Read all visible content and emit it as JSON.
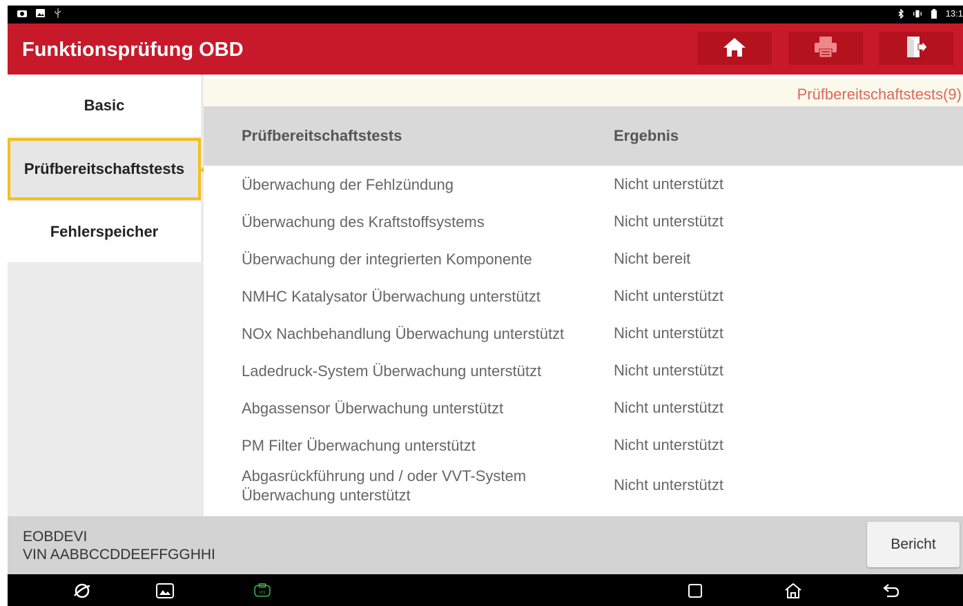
{
  "statusbar": {
    "time": "13:1",
    "left_icons": [
      "camera-icon",
      "image-icon",
      "usb-icon"
    ],
    "right_icons": [
      "bluetooth-icon",
      "vibrate-icon",
      "battery-icon"
    ]
  },
  "header": {
    "title": "Funktionsprüfung OBD",
    "color": "#c8192b",
    "buttons": [
      "home-icon",
      "printer-icon",
      "exit-icon"
    ]
  },
  "sidebar": {
    "items": [
      {
        "label": "Basic",
        "selected": false
      },
      {
        "label": "Prüfbereitschaftstests",
        "selected": true
      },
      {
        "label": "Fehlerspeicher",
        "selected": false
      }
    ],
    "highlight_color": "#f3c01a"
  },
  "content": {
    "notice": "Prüfbereitschaftstests(9)",
    "columns": [
      "Prüfbereitschaftstests",
      "Ergebnis"
    ],
    "rows": [
      {
        "test": "Überwachung der Fehlzündung",
        "result": "Nicht unterstützt"
      },
      {
        "test": "Überwachung des Kraftstoffsystems",
        "result": "Nicht unterstützt"
      },
      {
        "test": "Überwachung der integrierten Komponente",
        "result": "Nicht bereit"
      },
      {
        "test": "NMHC Katalysator Überwachung unterstützt",
        "result": "Nicht unterstützt"
      },
      {
        "test": "NOx Nachbehandlung Überwachung unterstützt",
        "result": "Nicht unterstützt"
      },
      {
        "test": "Ladedruck-System Überwachung unterstützt",
        "result": "Nicht unterstützt"
      },
      {
        "test": "Abgassensor Überwachung unterstützt",
        "result": "Nicht unterstützt"
      },
      {
        "test": "PM Filter Überwachung unterstützt",
        "result": "Nicht unterstützt"
      },
      {
        "test": "Abgasrückführung und / oder VVT-System Überwachung unterstützt",
        "result": "Nicht unterstützt"
      }
    ]
  },
  "footer": {
    "line1": "EOBDEVI",
    "line2": "VIN AABBCCDDEEFFGGHHI",
    "report_button": "Bericht"
  },
  "navbar": {
    "icons": [
      "browser-icon",
      "gallery-icon",
      "vci-icon",
      "recent-apps-icon",
      "home-nav-icon",
      "back-icon"
    ]
  }
}
